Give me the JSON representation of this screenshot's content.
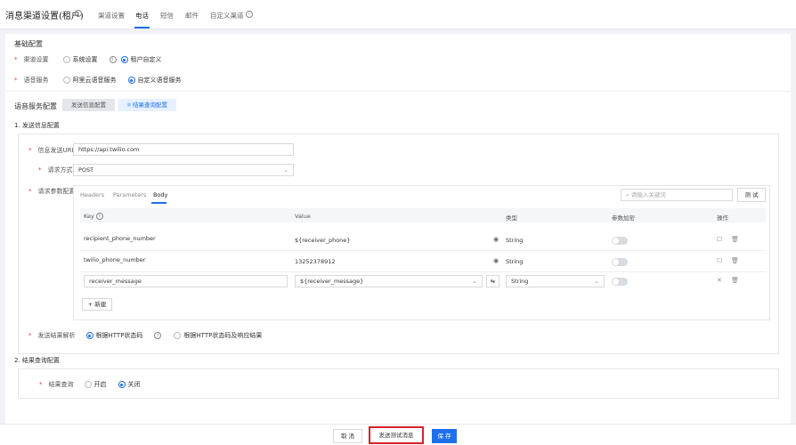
{
  "header": {
    "title": "消息渠道设置(租户)",
    "tabs": [
      {
        "label": "渠道设置"
      },
      {
        "label": "电话"
      },
      {
        "label": "短信"
      },
      {
        "label": "邮件"
      },
      {
        "label": "自定义渠道"
      }
    ]
  },
  "basic": {
    "title": "基础配置",
    "channel_label": "渠道设置",
    "channel_options": [
      "系统设置",
      "租户自定义"
    ],
    "channel_selected": "租户自定义",
    "voice_label": "语音服务",
    "voice_options": [
      "阿里云语音服务",
      "自定义语音服务"
    ],
    "voice_selected": "自定义语音服务"
  },
  "voice_config": {
    "title": "语音服务配置",
    "steps": [
      "发送信息配置",
      "结果查询配置"
    ],
    "active_step": "结果查询配置"
  },
  "send": {
    "title": "1. 发送信息配置",
    "url_label": "信息发送URL",
    "url_value": "https://api.twilio.com",
    "method_label": "请求方式",
    "method_value": "POST",
    "params_label": "请求参数配置",
    "param_tabs": [
      "Headers",
      "Parameters",
      "Body"
    ],
    "active_param_tab": "Body",
    "search_placeholder": "请输入关键词",
    "test_button": "测 试",
    "columns": [
      "Key",
      "Value",
      "类型",
      "参数加密",
      "操作"
    ],
    "rows": [
      {
        "key": "recipient_phone_number",
        "value": "${receiver_phone}",
        "type": "String"
      },
      {
        "key": "twilio_phone_number",
        "value": "13252378912",
        "type": "String"
      }
    ],
    "edit_row": {
      "key": "receiver_message",
      "value": "${receiver_message}",
      "type": "String"
    },
    "add_button": "+ 新建",
    "parse_label": "发送结果解析",
    "parse_options": [
      "根据HTTP状态码",
      "根据HTTP状态码及响应结果"
    ],
    "parse_selected": "根据HTTP状态码"
  },
  "query": {
    "title": "2. 结果查询配置",
    "label": "结果查询",
    "options": [
      "开启",
      "关闭"
    ],
    "selected": "关闭"
  },
  "footer": {
    "cancel": "取 消",
    "send_test": "发送测试消息",
    "save": "保 存"
  },
  "colors": {
    "primary": "#1f6feb",
    "highlight_border": "#d4232b"
  }
}
